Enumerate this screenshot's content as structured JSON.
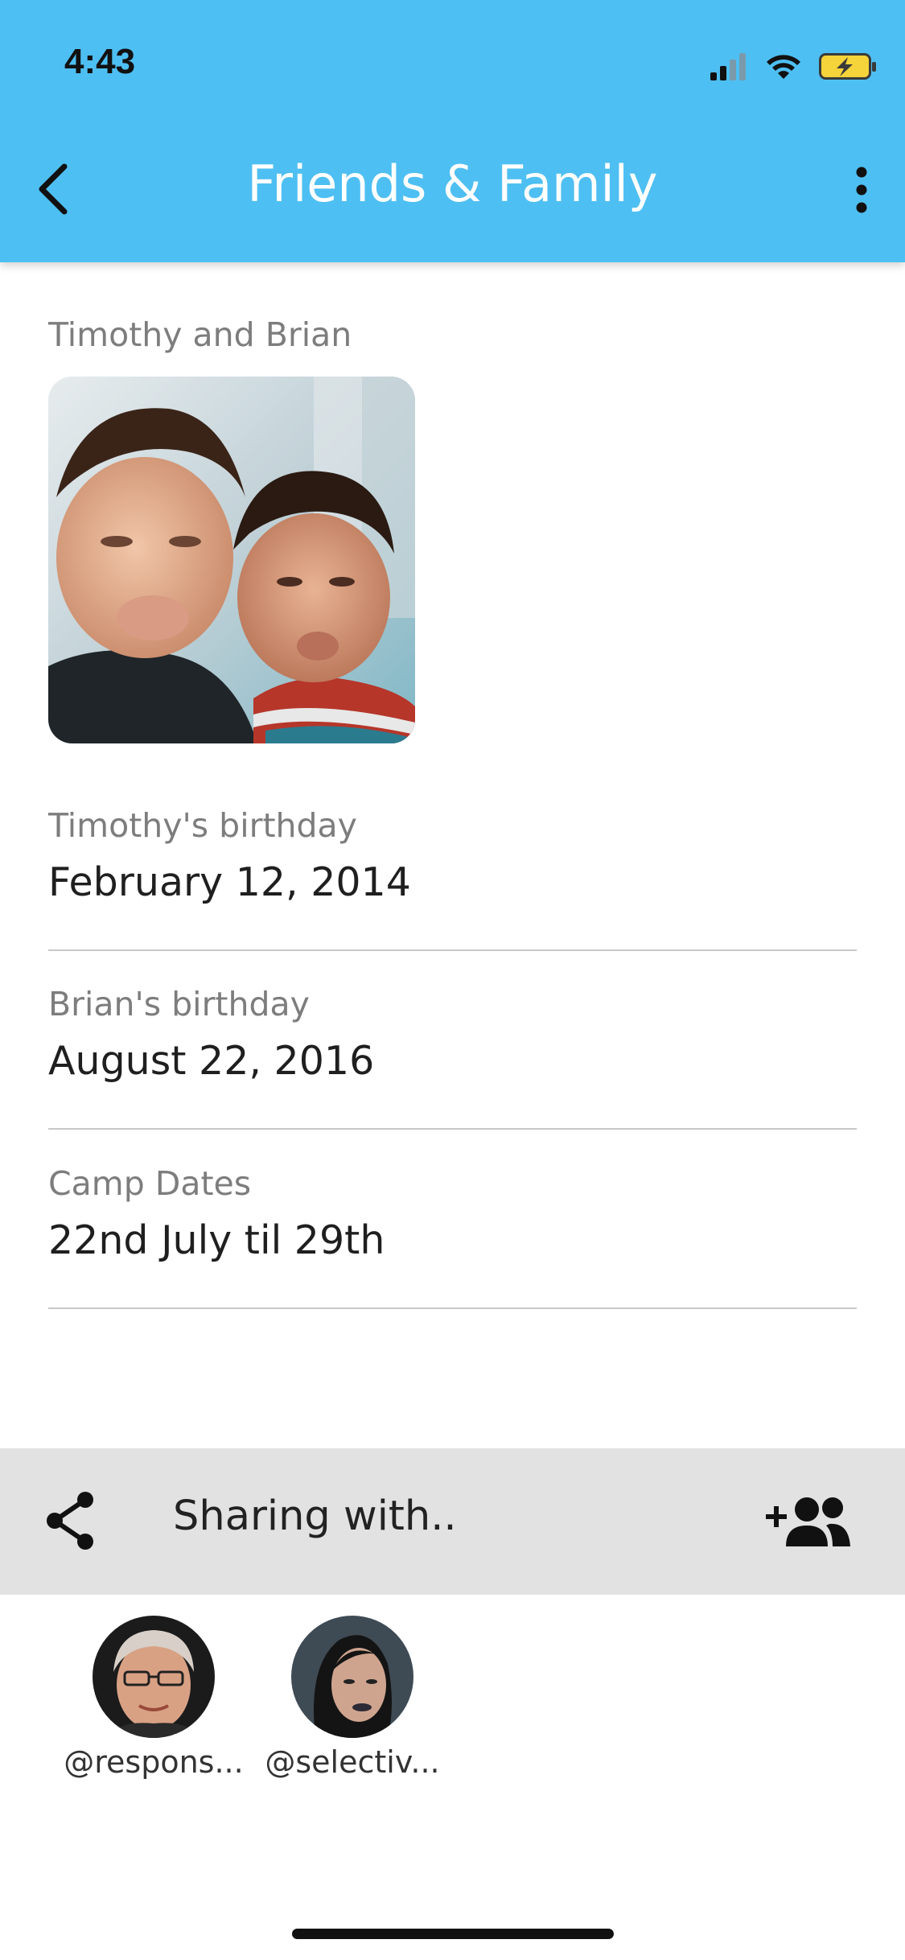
{
  "status_bar": {
    "time": "4:43"
  },
  "header": {
    "title": "Friends & Family",
    "background_color": "#4ebff2",
    "back_icon": "chevron-left-icon",
    "menu_icon": "more-vertical-icon"
  },
  "contact": {
    "photo_label": "Timothy and Brian",
    "fields": [
      {
        "label": "Timothy's birthday",
        "value": "February 12, 2014"
      },
      {
        "label": "Brian's birthday",
        "value": "August 22, 2016"
      },
      {
        "label": "Camp Dates",
        "value": "22nd July til 29th"
      }
    ]
  },
  "sharing": {
    "label": "Sharing with..",
    "share_icon": "share-icon",
    "add_icon": "add-people-icon",
    "people": [
      {
        "handle": "@respons..."
      },
      {
        "handle": "@selectiv..."
      }
    ]
  }
}
